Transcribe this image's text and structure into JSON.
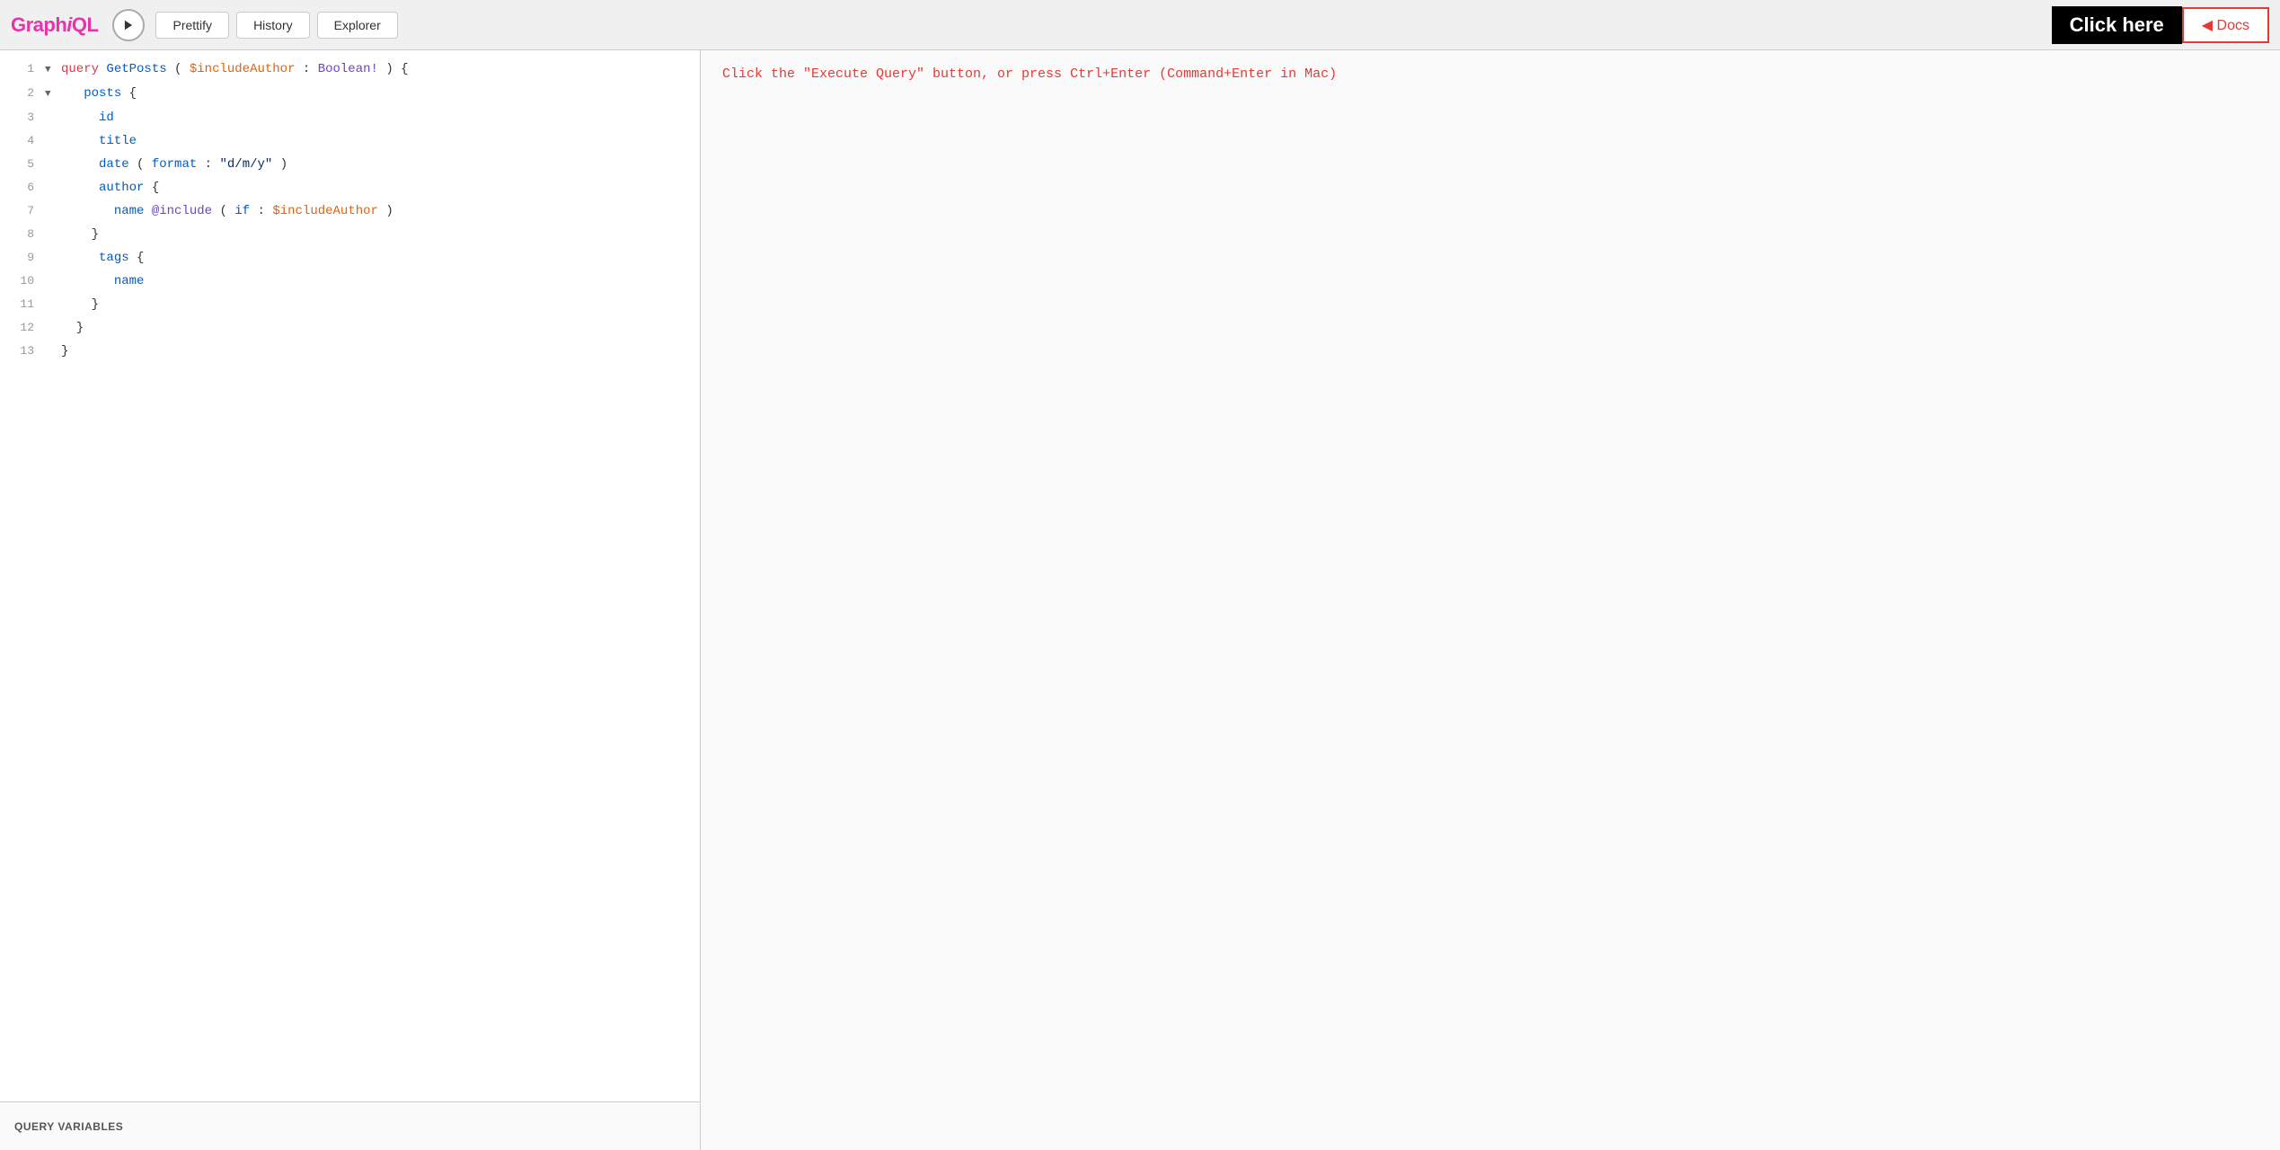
{
  "header": {
    "logo": "GraphiQL",
    "logo_italic": "i",
    "execute_label": "Execute Query",
    "prettify_label": "Prettify",
    "history_label": "History",
    "explorer_label": "Explorer",
    "click_here_label": "Click here",
    "docs_label": "◀ Docs"
  },
  "editor": {
    "query_vars_label": "QUERY VARIABLES"
  },
  "results": {
    "hint": "Click the \"Execute Query\" button, or press Ctrl+Enter (Command+Enter in Mac)"
  },
  "code_lines": [
    {
      "num": 1,
      "arrow": "▼",
      "content": "query_start"
    },
    {
      "num": 2,
      "arrow": "▼",
      "content": "posts_start"
    },
    {
      "num": 3,
      "arrow": "",
      "content": "id"
    },
    {
      "num": 4,
      "arrow": "",
      "content": "title"
    },
    {
      "num": 5,
      "arrow": "",
      "content": "date_format"
    },
    {
      "num": 6,
      "arrow": "",
      "content": "author_start"
    },
    {
      "num": 7,
      "arrow": "",
      "content": "name_include"
    },
    {
      "num": 8,
      "arrow": "",
      "content": "author_end"
    },
    {
      "num": 9,
      "arrow": "",
      "content": "tags_start"
    },
    {
      "num": 10,
      "arrow": "",
      "content": "tags_name"
    },
    {
      "num": 11,
      "arrow": "",
      "content": "tags_end"
    },
    {
      "num": 12,
      "arrow": "",
      "content": "posts_end"
    },
    {
      "num": 13,
      "arrow": "",
      "content": "query_end"
    }
  ]
}
